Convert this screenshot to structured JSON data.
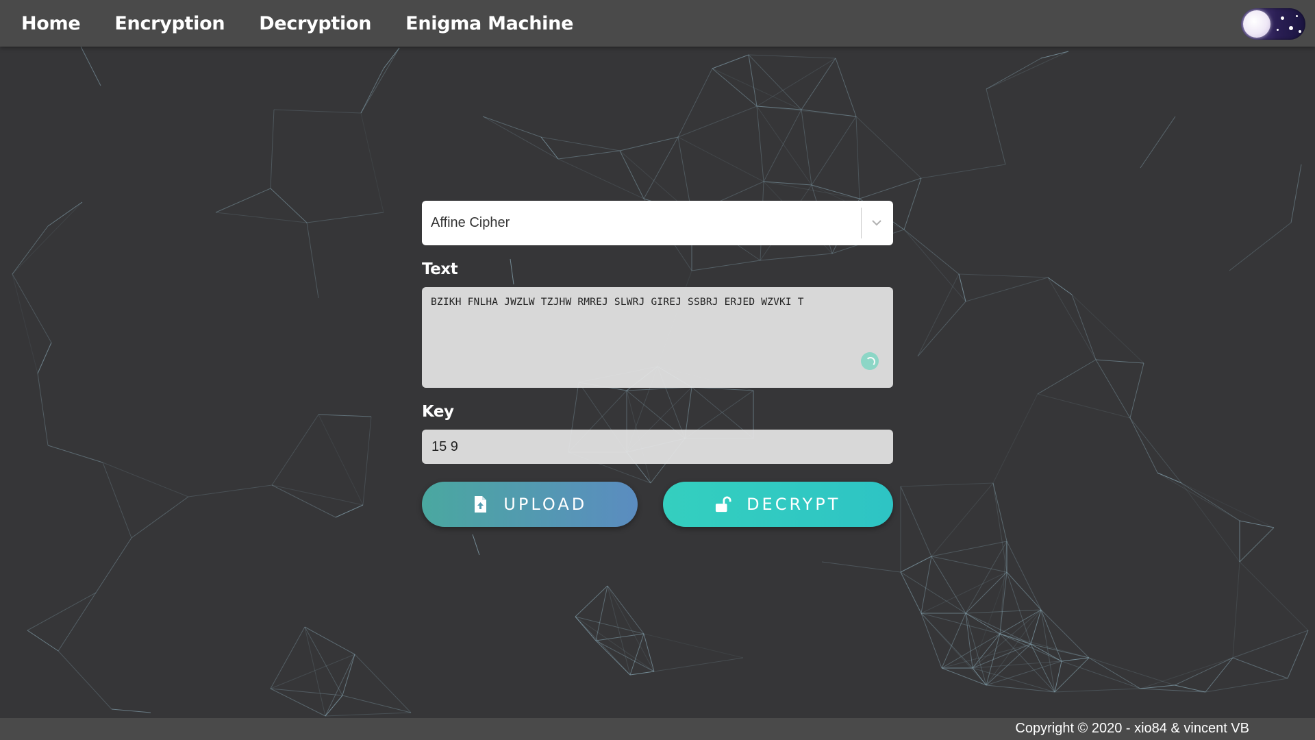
{
  "nav": {
    "items": [
      {
        "label": "Home"
      },
      {
        "label": "Encryption"
      },
      {
        "label": "Decryption"
      },
      {
        "label": "Enigma Machine"
      }
    ]
  },
  "cipher_select": {
    "value": "Affine Cipher",
    "icon": "chevron-down-icon"
  },
  "text_field": {
    "label": "Text",
    "value": "BZIKH FNLHA JWZLW TZJHW RMREJ SLWRJ GIREJ SSBRJ ERJED WZVKI T"
  },
  "key_field": {
    "label": "Key",
    "value": "15 9"
  },
  "buttons": {
    "upload_label": "UPLOAD",
    "decrypt_label": "DECRYPT"
  },
  "footer": {
    "copyright": "Copyright © 2020 - xio84 & vincent VB"
  },
  "colors": {
    "background": "#363638",
    "navbar": "#4a4a4a",
    "network_lines": "#9fc6d6",
    "upload_gradient": [
      "#4aa8a0",
      "#5b8cc0"
    ],
    "decrypt_color": "#34cfbf"
  }
}
